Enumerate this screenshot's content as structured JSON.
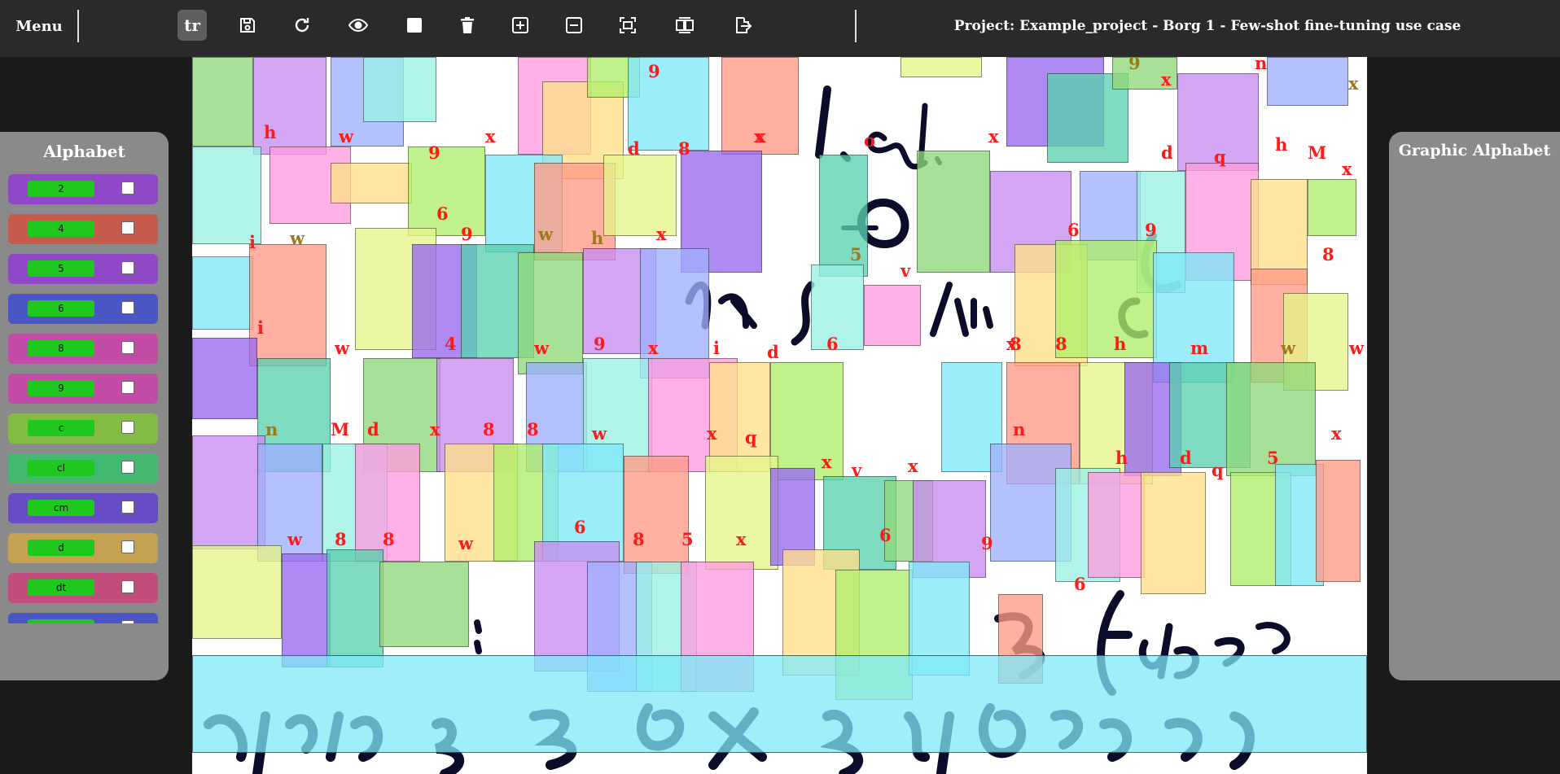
{
  "toolbar": {
    "menu_label": "Menu",
    "transcribe_label": "tr",
    "buttons": [
      {
        "name": "transcribe-button",
        "icon": "text-tr-icon"
      },
      {
        "name": "save-button",
        "icon": "floppy-disk-icon"
      },
      {
        "name": "redo-button",
        "icon": "rotate-clockwise-icon"
      },
      {
        "name": "toggle-visibility-button",
        "icon": "eye-icon"
      },
      {
        "name": "draw-box-button",
        "icon": "filled-square-icon"
      },
      {
        "name": "delete-button",
        "icon": "trash-icon"
      },
      {
        "name": "zoom-in-button",
        "icon": "plus-square-icon"
      },
      {
        "name": "zoom-out-button",
        "icon": "minus-square-icon"
      },
      {
        "name": "fit-view-button",
        "icon": "fit-screen-icon"
      },
      {
        "name": "compare-view-button",
        "icon": "split-view-icon"
      },
      {
        "name": "export-button",
        "icon": "file-export-icon"
      }
    ],
    "project_title": "Project: Example_project - Borg 1 - Few-shot fine-tuning use case"
  },
  "alphabet_panel": {
    "title": "Alphabet",
    "items": [
      {
        "label": "2",
        "color": "#8f49c6",
        "checked": false
      },
      {
        "label": "4",
        "color": "#c65a4c",
        "checked": false
      },
      {
        "label": "5",
        "color": "#8f49c6",
        "checked": false
      },
      {
        "label": "6",
        "color": "#4a55c6",
        "checked": false
      },
      {
        "label": "8",
        "color": "#c24ba6",
        "checked": false
      },
      {
        "label": "9",
        "color": "#c24ba6",
        "checked": false
      },
      {
        "label": "c",
        "color": "#84bb45",
        "checked": false
      },
      {
        "label": "cl",
        "color": "#43b871",
        "checked": false
      },
      {
        "label": "cm",
        "color": "#6a4bc6",
        "checked": false
      },
      {
        "label": "d",
        "color": "#c4a251",
        "checked": false
      },
      {
        "label": "dt",
        "color": "#c24c7b",
        "checked": false
      },
      {
        "label": "",
        "color": "#4a55c6",
        "checked": false
      }
    ]
  },
  "graphic_panel": {
    "title": "Graphic Alphabet"
  },
  "labels": [
    "9",
    "n",
    "x",
    "x",
    "h",
    "w",
    "x",
    "9",
    "d",
    "8",
    "x",
    "o",
    "x",
    "9",
    "x",
    "d",
    "q",
    "h",
    "M",
    "x",
    "6",
    "w",
    "9",
    "x",
    "h",
    "i",
    "w",
    "9",
    "6",
    "5",
    "v",
    "8",
    "x",
    "i",
    "w",
    "4",
    "w",
    "9",
    "x",
    "i",
    "d",
    "8",
    "x",
    "6",
    "8",
    "h",
    "m",
    "w",
    "w",
    "n",
    "M",
    "d",
    "x",
    "8",
    "8",
    "w",
    "x",
    "q",
    "n",
    "x",
    "5",
    "h",
    "h",
    "d",
    "q",
    "x",
    "v",
    "x",
    "w",
    "8",
    "8",
    "w",
    "6",
    "8",
    "5",
    "x",
    "6",
    "9",
    "6",
    "4"
  ],
  "colors": {
    "topbar": "#2a2a2a",
    "panel": "#8a8a8a",
    "label_red": "#ff1a1a",
    "label_olive": "#9a7a1a",
    "ink": "#0b0b2a"
  }
}
